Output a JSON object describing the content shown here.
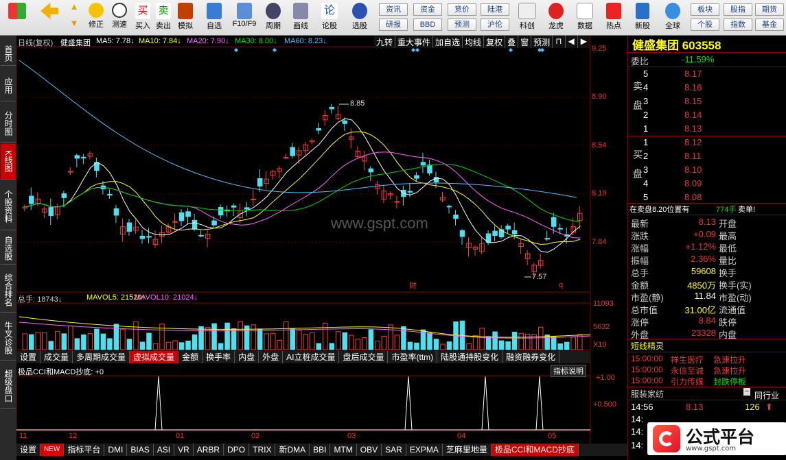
{
  "toolbar": {
    "items": [
      "买入",
      "卖出",
      "模拟",
      "自选",
      "F10/F9",
      "周期",
      "画线",
      "论股",
      "选股",
      "科创",
      "龙虎",
      "数据",
      "热点",
      "新股",
      "全球"
    ],
    "small": [
      "修正",
      "测速",
      "资讯",
      "资金",
      "竞价",
      "陆港",
      "研报",
      "BBD",
      "预测",
      "沪伦",
      "板块",
      "股指",
      "期货",
      "个股",
      "指数",
      "基金"
    ]
  },
  "sidebar": [
    "首页",
    "应用",
    "分时图",
    "K线图",
    "个股资料",
    "自选股",
    "综合排名",
    "牛叉诊股",
    "超级盘口"
  ],
  "header": {
    "period": "日线(复权)",
    "stock": "健盛集团",
    "ma5": "MA5: 7.78↓",
    "ma10": "MA10: 7.84↓",
    "ma20": "MA20: 7.90↓",
    "ma30": "MA30: 8.00↓",
    "ma60": "MA60: 8.23↓",
    "tools": [
      "九转",
      "重大事件",
      "加自选",
      "均线",
      "复权",
      "叠",
      "窗",
      "预测"
    ]
  },
  "price_axis": [
    "9.25",
    "8.90",
    "8.54",
    "8.19",
    "7.84"
  ],
  "annot": {
    "high": "8.85",
    "low": "7.57",
    "cai": "财",
    "q": "q"
  },
  "watermark": "www.gspt.com",
  "vol": {
    "title": "总手: 18743↓",
    "mavol5": "MAVOL5: 21520↑",
    "mavol10": "MAVOL10: 21024↓",
    "ax1": "11093",
    "ax2": "5632",
    "ax3": "X10"
  },
  "tabs1": [
    "设置",
    "成交量",
    "多周期成交量",
    "虚拟成交量",
    "金额",
    "换手率",
    "内盘",
    "外盘",
    "AI立桩成交量",
    "盘后成交量",
    "市盈率(ttm)",
    "陆股通持股变化",
    "融资融券变化"
  ],
  "cci": {
    "title": "极品CCI和MACD抄底: +0",
    "btn": "指标说明",
    "ax1": "+1.00",
    "ax2": "+0.500"
  },
  "months": [
    "11",
    "12",
    "01",
    "02",
    "03",
    "04",
    "05"
  ],
  "tabs2": [
    "设置",
    "NEW",
    "指标平台",
    "DMI",
    "BIAS",
    "ASI",
    "VR",
    "ARBR",
    "DPO",
    "TRIX",
    "新DMA",
    "BBI",
    "MTM",
    "OBV",
    "SAR",
    "EXPMA",
    "芝麻里地量",
    "极品CCI和MACD抄底"
  ],
  "panel": {
    "title": "健盛集团 603558",
    "weibi_l": "委比",
    "weibi": "-11.59%",
    "sell": [
      [
        "5",
        "8.17"
      ],
      [
        "4",
        "8.16"
      ],
      [
        "3",
        "8.15"
      ],
      [
        "2",
        "8.14"
      ],
      [
        "1",
        "8.13"
      ]
    ],
    "buy": [
      [
        "1",
        "8.12"
      ],
      [
        "2",
        "8.11"
      ],
      [
        "3",
        "8.10"
      ],
      [
        "4",
        "8.09"
      ],
      [
        "5",
        "8.08"
      ]
    ],
    "sell_lbl": "卖盘",
    "buy_lbl": "买盘",
    "zaimai": "在卖盘8.20位置有",
    "zaimai_v": "774手",
    "zaimai_t": "卖单!",
    "stats": [
      [
        "最新",
        "8.13",
        "开盘"
      ],
      [
        "涨跌",
        "+0.09",
        "最高"
      ],
      [
        "涨幅",
        "+1.12%",
        "最低"
      ],
      [
        "振幅",
        "2.36%",
        "量比"
      ],
      [
        "总手",
        "59608",
        "换手"
      ],
      [
        "金额",
        "4850万",
        "换手(实)"
      ],
      [
        "市盈(静)",
        "11.84",
        "市盈(动)"
      ],
      [
        "总市值",
        "31.00亿",
        "流通值"
      ],
      [
        "涨停",
        "8.84",
        "跌停"
      ],
      [
        "外盘",
        "23328",
        "内盘"
      ]
    ],
    "short_title": "短线精灵",
    "short": [
      [
        "15:00:00",
        "祥生医疗",
        "急速拉升"
      ],
      [
        "15:00:00",
        "永信至诚",
        "急速拉升"
      ],
      [
        "15:00:00",
        "引力传媒",
        "封跌停板"
      ]
    ],
    "sector": "服装家纺",
    "sector_r": "同行业",
    "tick": [
      "14:56",
      "8.13",
      "126"
    ],
    "brand": "公式平台",
    "brand_url": "www.gspt.com"
  }
}
